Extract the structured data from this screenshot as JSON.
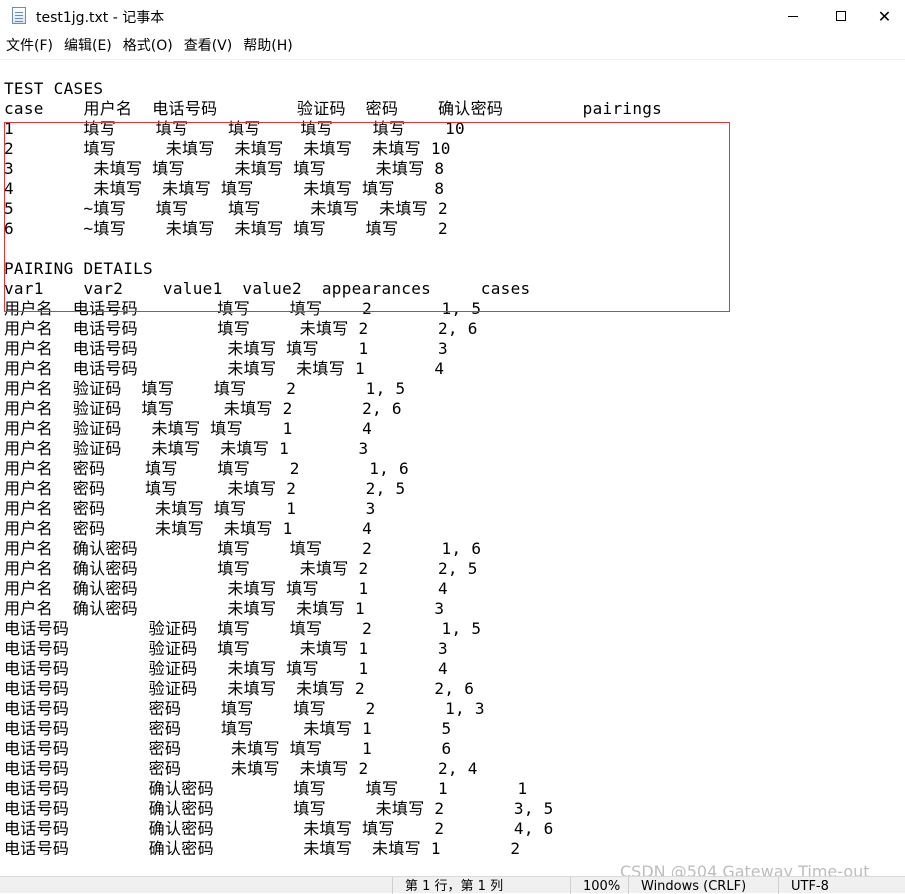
{
  "window": {
    "title": "test1jg.txt - 记事本",
    "minimize_glyph": "minimize-icon",
    "maximize_glyph": "maximize-icon",
    "close_symbol": "✕"
  },
  "menu": {
    "file": "文件(F)",
    "edit": "编辑(E)",
    "format": "格式(O)",
    "view": "查看(V)",
    "help": "帮助(H)"
  },
  "editor": {
    "content": "TEST CASES\ncase    用户名  电话号码        验证码  密码    确认密码        pairings\n1       填写    填写    填写    填写    填写    10\n2       填写     未填写  未填写  未填写  未填写 10\n3        未填写 填写     未填写 填写     未填写 8\n4        未填写  未填写 填写     未填写 填写    8\n5       ~填写   填写    填写     未填写  未填写 2\n6       ~填写    未填写  未填写 填写    填写    2\n\nPAIRING DETAILS\nvar1    var2    value1  value2  appearances     cases\n用户名  电话号码        填写    填写    2       1, 5\n用户名  电话号码        填写     未填写 2       2, 6\n用户名  电话号码         未填写 填写    1       3\n用户名  电话号码         未填写  未填写 1       4\n用户名  验证码  填写    填写    2       1, 5\n用户名  验证码  填写     未填写 2       2, 6\n用户名  验证码   未填写 填写    1       4\n用户名  验证码   未填写  未填写 1       3\n用户名  密码    填写    填写    2       1, 6\n用户名  密码    填写     未填写 2       2, 5\n用户名  密码     未填写 填写    1       3\n用户名  密码     未填写  未填写 1       4\n用户名  确认密码        填写    填写    2       1, 6\n用户名  确认密码        填写     未填写 2       2, 5\n用户名  确认密码         未填写 填写    1       4\n用户名  确认密码         未填写  未填写 1       3\n电话号码        验证码  填写    填写    2       1, 5\n电话号码        验证码  填写     未填写 1       3\n电话号码        验证码   未填写 填写    1       4\n电话号码        验证码   未填写  未填写 2       2, 6\n电话号码        密码    填写    填写    2       1, 3\n电话号码        密码    填写     未填写 1       5\n电话号码        密码     未填写 填写    1       6\n电话号码        密码     未填写  未填写 2       2, 4\n电话号码        确认密码        填写    填写    1       1\n电话号码        确认密码        填写     未填写 2       3, 5\n电话号码        确认密码         未填写 填写    2       4, 6\n电话号码        确认密码         未填写  未填写 1       2"
  },
  "statusbar": {
    "position": "第 1 行，第 1 列",
    "zoom": "100%",
    "line_ending": "Windows (CRLF)",
    "encoding": "UTF-8"
  },
  "watermark": "CSDN @504 Gateway Time-out",
  "colors": {
    "highlight_border": "#e0373a"
  }
}
